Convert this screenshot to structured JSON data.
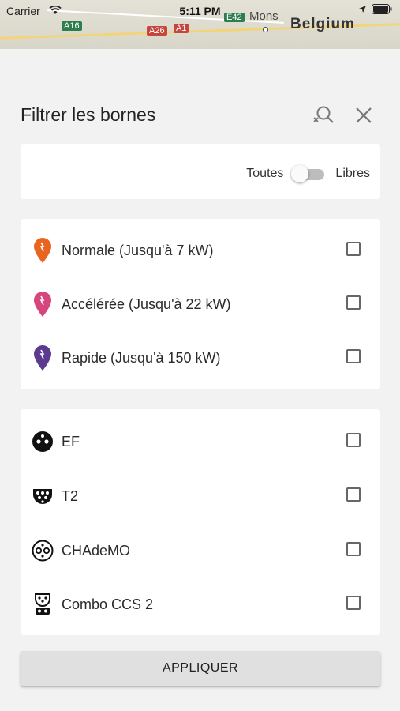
{
  "status_bar": {
    "carrier": "Carrier",
    "time": "5:11 PM"
  },
  "map": {
    "city": "Mons",
    "country": "Belgium",
    "roads": [
      "A16",
      "A26",
      "A1",
      "E42"
    ]
  },
  "header": {
    "title": "Filtrer les bornes"
  },
  "availability": {
    "left_label": "Toutes",
    "right_label": "Libres",
    "toggle_on": false
  },
  "power": [
    {
      "label": "Normale (Jusqu'à 7 kW)",
      "color": "#e8641f",
      "checked": false
    },
    {
      "label": "Accélérée (Jusqu'à 22 kW)",
      "color": "#d6457d",
      "checked": false
    },
    {
      "label": "Rapide (Jusqu'à 150 kW)",
      "color": "#5b3a8f",
      "checked": false
    }
  ],
  "connectors": [
    {
      "label": "EF",
      "icon": "ef-plug-icon",
      "checked": false
    },
    {
      "label": "T2",
      "icon": "type2-plug-icon",
      "checked": false
    },
    {
      "label": "CHAdeMO",
      "icon": "chademo-plug-icon",
      "checked": false
    },
    {
      "label": "Combo CCS 2",
      "icon": "ccs2-plug-icon",
      "checked": false
    }
  ],
  "apply_label": "APPLIQUER"
}
